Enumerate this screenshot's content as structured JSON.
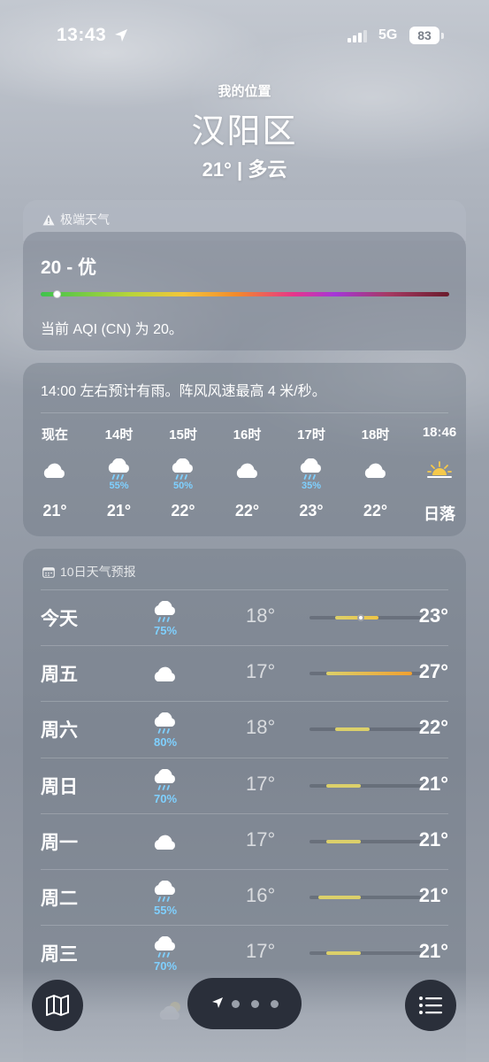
{
  "status_bar": {
    "time": "13:43",
    "network": "5G",
    "battery": "83"
  },
  "header": {
    "subtitle": "我的位置",
    "city": "汉阳区",
    "condition": "21° | 多云"
  },
  "alert": {
    "label": "极端天气"
  },
  "aqi": {
    "value": "20 - 优",
    "description": "当前 AQI (CN) 为 20。",
    "level_fraction": 0.04
  },
  "hourly": {
    "summary": "14:00 左右预计有雨。阵风风速最高 4 米/秒。",
    "hours": [
      {
        "label": "现在",
        "icon": "cloud-icon",
        "pct": "",
        "temp": "21°"
      },
      {
        "label": "14时",
        "icon": "cloud-rain-icon",
        "pct": "55%",
        "temp": "21°"
      },
      {
        "label": "15时",
        "icon": "cloud-rain-icon",
        "pct": "50%",
        "temp": "22°"
      },
      {
        "label": "16时",
        "icon": "cloud-icon",
        "pct": "",
        "temp": "22°"
      },
      {
        "label": "17时",
        "icon": "cloud-rain-icon",
        "pct": "35%",
        "temp": "23°"
      },
      {
        "label": "18时",
        "icon": "cloud-icon",
        "pct": "",
        "temp": "22°"
      },
      {
        "label": "18:46",
        "icon": "sunset-icon",
        "pct": "",
        "temp": "日落"
      }
    ]
  },
  "forecast": {
    "title": "10日天气预报",
    "days": [
      {
        "name": "今天",
        "icon": "cloud-rain-icon",
        "pct": "75%",
        "low": "18°",
        "high": "23°",
        "low_val": 18,
        "high_val": 23,
        "current_val": 21
      },
      {
        "name": "周五",
        "icon": "cloud-icon",
        "pct": "",
        "low": "17°",
        "high": "27°",
        "low_val": 17,
        "high_val": 27
      },
      {
        "name": "周六",
        "icon": "cloud-rain-icon",
        "pct": "80%",
        "low": "18°",
        "high": "22°",
        "low_val": 18,
        "high_val": 22
      },
      {
        "name": "周日",
        "icon": "cloud-rain-icon",
        "pct": "70%",
        "low": "17°",
        "high": "21°",
        "low_val": 17,
        "high_val": 21
      },
      {
        "name": "周一",
        "icon": "cloud-icon",
        "pct": "",
        "low": "17°",
        "high": "21°",
        "low_val": 17,
        "high_val": 21
      },
      {
        "name": "周二",
        "icon": "cloud-rain-icon",
        "pct": "55%",
        "low": "16°",
        "high": "21°",
        "low_val": 16,
        "high_val": 21
      },
      {
        "name": "周三",
        "icon": "cloud-rain-icon",
        "pct": "70%",
        "low": "17°",
        "high": "21°",
        "low_val": 17,
        "high_val": 21
      }
    ],
    "range_min": 15,
    "range_max": 28
  },
  "bottom_bar": {
    "map_icon": "map-icon",
    "list_icon": "list-icon",
    "location_icon": "location-arrow-icon",
    "page_dots": 3
  },
  "colors": {
    "rain_pct": "#7fd0ff",
    "card_bg": "#6e7684"
  }
}
